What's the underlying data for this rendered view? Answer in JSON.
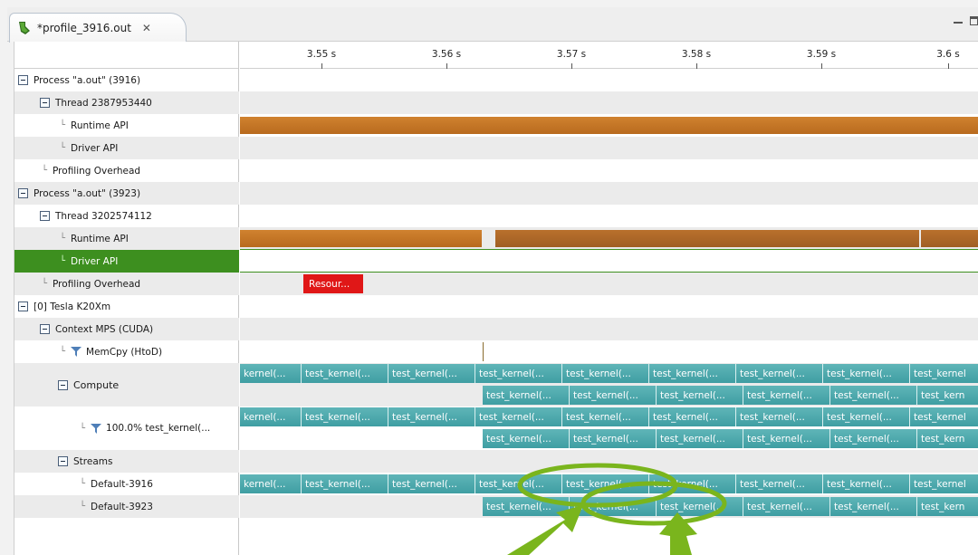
{
  "editor_tab": {
    "title": "*profile_3916.out",
    "close_glyph": "✕"
  },
  "icons": {
    "tab": "profile-file-icon",
    "expander": "collapse-icon",
    "filter": "filter-icon"
  },
  "colors": {
    "runtime_api": "#c47425",
    "resource_marker": "#e01717",
    "kernel": "#4aa7ab",
    "selected_row": "#3d8f1f",
    "annotation": "#7ab51d"
  },
  "ruler": {
    "ticks": [
      "3.55 s",
      "3.56 s",
      "3.57 s",
      "3.58 s",
      "3.59 s",
      "3.6 s"
    ]
  },
  "tree": {
    "rows": [
      {
        "label": "Process \"a.out\" (3916)"
      },
      {
        "label": "Thread 2387953440"
      },
      {
        "label": "Runtime API"
      },
      {
        "label": "Driver API"
      },
      {
        "label": "Profiling Overhead"
      },
      {
        "label": "Process \"a.out\" (3923)"
      },
      {
        "label": "Thread 3202574112"
      },
      {
        "label": "Runtime API"
      },
      {
        "label": "Driver API"
      },
      {
        "label": "Profiling Overhead"
      },
      {
        "label": "[0] Tesla K20Xm"
      },
      {
        "label": "Context MPS (CUDA)"
      },
      {
        "label": "MemCpy (HtoD)"
      },
      {
        "label": "Compute"
      },
      {
        "label": "100.0% test_kernel(..."
      },
      {
        "label": "Streams"
      },
      {
        "label": "Default-3916"
      },
      {
        "label": "Default-3923"
      }
    ]
  },
  "timeline": {
    "resource_marker": "Resour...",
    "kernel_label": "test_kernel(...",
    "kernel_label_cut": "kernel(...",
    "kernel_label_end": "test_kernel",
    "kernel_label_end2": "test_kern"
  }
}
